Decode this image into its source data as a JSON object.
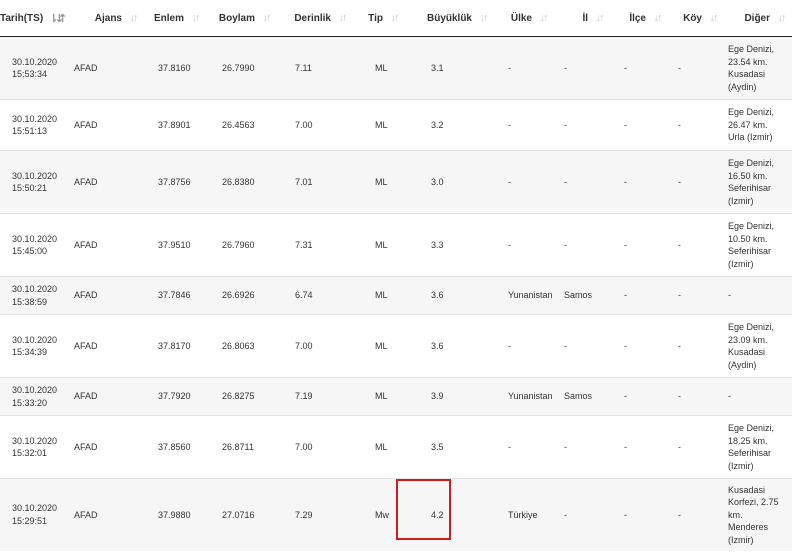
{
  "headers": [
    "Tarih(TS)",
    "Ajans",
    "Enlem",
    "Boylam",
    "Derinlik",
    "Tip",
    "Büyüklük",
    "Ülke",
    "İl",
    "İlçe",
    "Köy",
    "Diğer"
  ],
  "sort_icons": {
    "active": "⇂⇵",
    "inactive": "↓↑"
  },
  "rows": [
    {
      "date": "30.10.2020",
      "time": "15:53:34",
      "ajans": "AFAD",
      "enlem": "37.8160",
      "boylam": "26.7990",
      "derinlik": "7.11",
      "tip": "ML",
      "buyukluk": "3.1",
      "ulke": "-",
      "il": "-",
      "ilce": "-",
      "koy": "-",
      "diger": [
        "Ege Denizi,",
        "23.54 km.",
        "Kusadasi",
        "(Aydin)"
      ]
    },
    {
      "date": "30.10.2020",
      "time": "15:51:13",
      "ajans": "AFAD",
      "enlem": "37.8901",
      "boylam": "26.4563",
      "derinlik": "7.00",
      "tip": "ML",
      "buyukluk": "3.2",
      "ulke": "-",
      "il": "-",
      "ilce": "-",
      "koy": "-",
      "diger": [
        "Ege Denizi,",
        "26.47 km.",
        "Urla (Izmir)"
      ]
    },
    {
      "date": "30.10.2020",
      "time": "15:50:21",
      "ajans": "AFAD",
      "enlem": "37.8756",
      "boylam": "26.8380",
      "derinlik": "7.01",
      "tip": "ML",
      "buyukluk": "3.0",
      "ulke": "-",
      "il": "-",
      "ilce": "-",
      "koy": "-",
      "diger": [
        "Ege Denizi,",
        "16.50 km.",
        "Seferihisar",
        "(Izmir)"
      ]
    },
    {
      "date": "30.10.2020",
      "time": "15:45:00",
      "ajans": "AFAD",
      "enlem": "37.9510",
      "boylam": "26.7960",
      "derinlik": "7.31",
      "tip": "ML",
      "buyukluk": "3.3",
      "ulke": "-",
      "il": "-",
      "ilce": "-",
      "koy": "-",
      "diger": [
        "Ege Denizi,",
        "10.50 km.",
        "Seferihisar",
        "(Izmir)"
      ]
    },
    {
      "date": "30.10.2020",
      "time": "15:38:59",
      "ajans": "AFAD",
      "enlem": "37.7846",
      "boylam": "26.6926",
      "derinlik": "6.74",
      "tip": "ML",
      "buyukluk": "3.6",
      "ulke": "Yunanistan",
      "il": "Samos",
      "ilce": "-",
      "koy": "-",
      "diger": [
        "-"
      ]
    },
    {
      "date": "30.10.2020",
      "time": "15:34:39",
      "ajans": "AFAD",
      "enlem": "37.8170",
      "boylam": "26.8063",
      "derinlik": "7.00",
      "tip": "ML",
      "buyukluk": "3.6",
      "ulke": "-",
      "il": "-",
      "ilce": "-",
      "koy": "-",
      "diger": [
        "Ege Denizi,",
        "23.09 km.",
        "Kusadasi",
        "(Aydin)"
      ]
    },
    {
      "date": "30.10.2020",
      "time": "15:33:20",
      "ajans": "AFAD",
      "enlem": "37.7920",
      "boylam": "26.8275",
      "derinlik": "7.19",
      "tip": "ML",
      "buyukluk": "3.9",
      "ulke": "Yunanistan",
      "il": "Samos",
      "ilce": "-",
      "koy": "-",
      "diger": [
        "-"
      ]
    },
    {
      "date": "30.10.2020",
      "time": "15:32:01",
      "ajans": "AFAD",
      "enlem": "37.8560",
      "boylam": "26.8711",
      "derinlik": "7.00",
      "tip": "ML",
      "buyukluk": "3.5",
      "ulke": "-",
      "il": "-",
      "ilce": "-",
      "koy": "-",
      "diger": [
        "Ege Denizi,",
        "18.25 km.",
        "Seferihisar",
        "(Izmir)"
      ]
    },
    {
      "date": "30.10.2020",
      "time": "15:29:51",
      "ajans": "AFAD",
      "enlem": "37.9880",
      "boylam": "27.0716",
      "derinlik": "7.29",
      "tip": "Mw",
      "buyukluk": "4.2",
      "ulke": "Türkiye",
      "il": "-",
      "ilce": "-",
      "koy": "-",
      "diger": [
        "Kusadasi",
        "Korfezi, 2.75",
        "km.",
        "Menderes",
        "(Izmir)"
      ]
    }
  ],
  "highlight": {
    "row": 8,
    "column": "Büyüklük",
    "color": "#d21c1c"
  }
}
